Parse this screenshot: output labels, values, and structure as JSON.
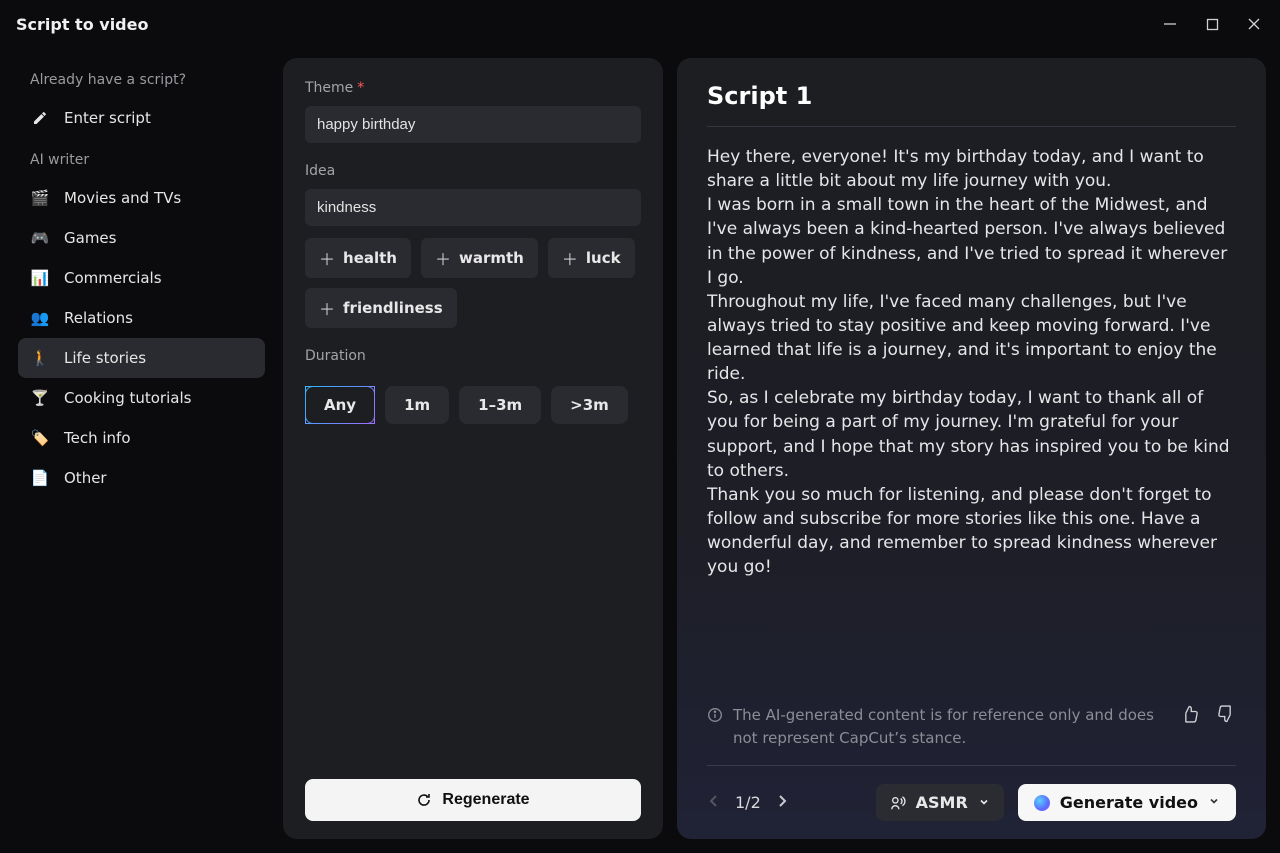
{
  "window": {
    "title": "Script to video"
  },
  "sidebar": {
    "prompt": "Already have a script?",
    "enter_script": "Enter script",
    "ai_writer_label": "AI writer",
    "items": [
      {
        "label": "Movies and TVs",
        "icon": "🎬"
      },
      {
        "label": "Games",
        "icon": "🎮"
      },
      {
        "label": "Commercials",
        "icon": "📊"
      },
      {
        "label": "Relations",
        "icon": "👥"
      },
      {
        "label": "Life stories",
        "icon": "🚶"
      },
      {
        "label": "Cooking tutorials",
        "icon": "🍸"
      },
      {
        "label": "Tech info",
        "icon": "🏷️"
      },
      {
        "label": "Other",
        "icon": "📄"
      }
    ]
  },
  "form": {
    "theme_label": "Theme",
    "theme_value": "happy birthday",
    "idea_label": "Idea",
    "idea_value": "kindness",
    "suggestions": [
      "health",
      "warmth",
      "luck",
      "friendliness"
    ],
    "duration_label": "Duration",
    "durations": [
      "Any",
      "1m",
      "1–3m",
      ">3m"
    ],
    "duration_selected": "Any",
    "regenerate": "Regenerate"
  },
  "script": {
    "title": "Script 1",
    "body": "Hey there, everyone! It's my birthday today, and I want to share a little bit about my life journey with you.\nI was born in a small town in the heart of the Midwest, and I've always been a kind-hearted person. I've always believed in the power of kindness, and I've tried to spread it wherever I go.\nThroughout my life, I've faced many challenges, but I've always tried to stay positive and keep moving forward. I've learned that life is a journey, and it's important to enjoy the ride.\nSo, as I celebrate my birthday today, I want to thank all of you for being a part of my journey. I'm grateful for your support, and I hope that my story has inspired you to be kind to others.\nThank you so much for listening, and please don't forget to follow and subscribe for more stories like this one. Have a wonderful day, and remember to spread kindness wherever you go!",
    "disclaimer": "The AI-generated content is for reference only and does not represent CapCut’s stance.",
    "pager": "1/2",
    "voice_label": "ASMR",
    "generate_label": "Generate video"
  }
}
